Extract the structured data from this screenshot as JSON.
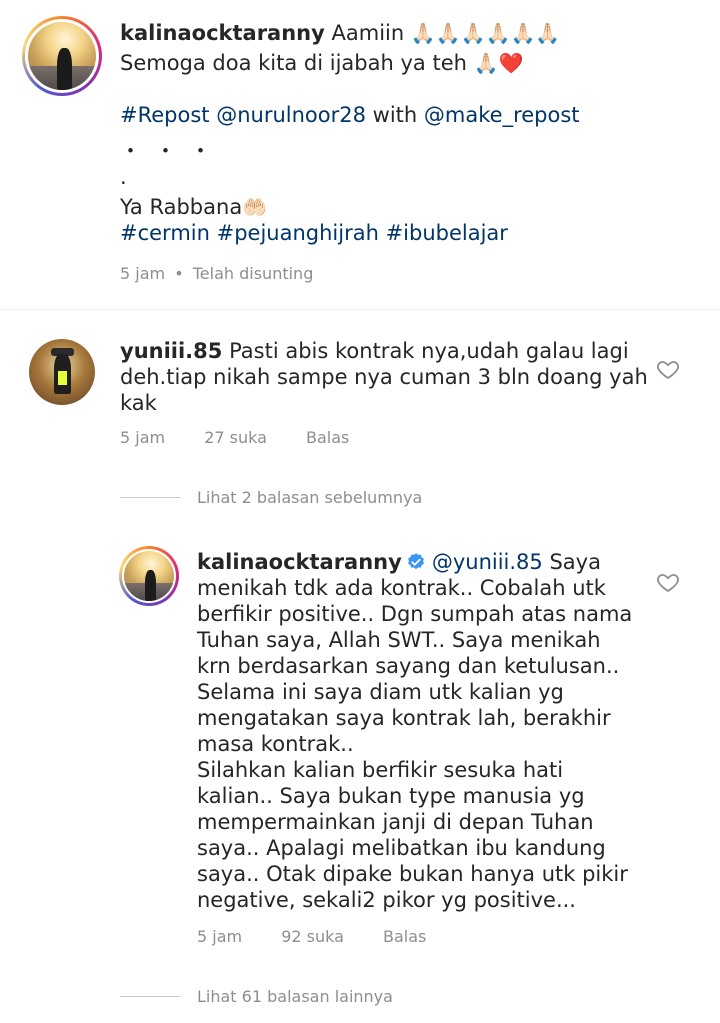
{
  "caption": {
    "username": "kalinaocktaranny",
    "line1_text": "Aamiin",
    "line1_emoji": "🙏🏻🙏🏻🙏🏻🙏🏻🙏🏻🙏🏻",
    "line2_text": "Semoga doa kita di ijabah ya teh",
    "line2_emoji": "🙏🏻❤️",
    "repost_tag": "#Repost",
    "repost_user": "@nurulnoor28",
    "repost_with": "with",
    "repost_app": "@make_repost",
    "dots": "・・・",
    "period": ".",
    "prayer_text": "Ya Rabbana",
    "prayer_emoji": "🤲🏻",
    "hashtags": "#cermin #pejuanghijrah #ibubelajar",
    "time": "5 jam",
    "separator": "•",
    "edited": "Telah disunting"
  },
  "comments": [
    {
      "username": "yuniii.85",
      "lines": [
        "Pasti abis kontrak nya,udah galau lagi",
        "deh.tiap nikah sampe nya cuman 3 bln doang yah",
        "kak"
      ],
      "time": "5 jam",
      "likes": "27 suka",
      "reply": "Balas"
    }
  ],
  "view_previous": "Lihat 2 balasan sebelumnya",
  "reply": {
    "username": "kalinaocktaranny",
    "mention": "@yuniii.85",
    "lines": [
      "Saya",
      "menikah tdk ada kontrak.. Cobalah utk",
      "berfikir positive.. Dgn sumpah atas nama",
      "Tuhan saya, Allah SWT.. Saya menikah",
      "krn berdasarkan sayang dan ketulusan..",
      "Selama ini saya diam utk kalian yg",
      "mengatakan saya kontrak lah, berakhir",
      "masa kontrak..",
      "Silahkan kalian berfikir sesuka hati",
      "kalian.. Saya bukan type manusia yg",
      "mempermainkan janji di depan Tuhan",
      "saya.. Apalagi melibatkan ibu kandung",
      "saya.. Otak dipake bukan hanya utk pikir",
      "negative, sekali2 pikor yg positive..."
    ],
    "time": "5 jam",
    "likes": "92 suka",
    "reply": "Balas"
  },
  "view_more": "Lihat 61 balasan lainnya",
  "colors": {
    "hashtag": "#003569",
    "meta": "#8e8e8e",
    "verified": "#3897f0",
    "heart_stroke": "#8e8e8e"
  },
  "icons": {
    "heart": "heart-icon",
    "verified": "verified-badge-icon"
  }
}
